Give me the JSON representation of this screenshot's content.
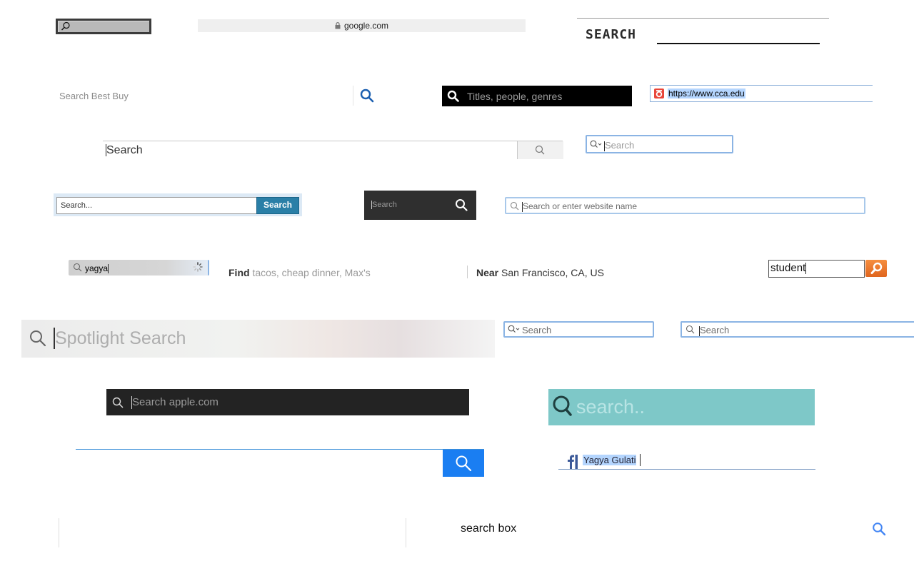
{
  "boxes": {
    "url_bar": {
      "text": "google.com"
    },
    "pixel": {
      "label": "SEARCH"
    },
    "bestbuy": {
      "placeholder": "Search Best Buy"
    },
    "netflix": {
      "placeholder": "Titles, people, genres"
    },
    "cca": {
      "url": "https://www.cca.edu"
    },
    "google": {
      "text": "Search"
    },
    "mac_small_1": {
      "placeholder": "Search"
    },
    "blue_form": {
      "placeholder": "Search...",
      "button": "Search"
    },
    "dark_form": {
      "placeholder": "Search"
    },
    "safari": {
      "placeholder": "Search or enter website name"
    },
    "loading": {
      "value": "yagya"
    },
    "yelp": {
      "find_label": "Find",
      "find_placeholder": "tacos, cheap dinner, Max's",
      "near_label": "Near",
      "near_value": "San Francisco, CA, US"
    },
    "student": {
      "value": "student"
    },
    "spotlight": {
      "placeholder": "Spotlight Search"
    },
    "mac_small_2": {
      "placeholder": "Search"
    },
    "mac_small_3": {
      "placeholder": "Search"
    },
    "apple": {
      "placeholder": "Search apple.com"
    },
    "teal": {
      "placeholder": "search.."
    },
    "facebook": {
      "selected_text": "Yagya Gulati"
    },
    "google_box": {
      "value": "search box"
    }
  },
  "colors": {
    "netflix_bg": "#000000",
    "blue_button": "#2a7fa7",
    "orange_button": "#e0651e",
    "teal_bg": "#7ec8c8",
    "apple_bg": "#232323",
    "blue_search_button": "#1a7ef2",
    "google_blue": "#4285f4",
    "bestbuy_blue": "#1b5fb0",
    "facebook_blue": "#3b5998",
    "focus_ring": "#8bb4e4"
  },
  "icons": [
    "magnifier-icon",
    "lock-icon",
    "spinner-icon",
    "facebook-logo-icon",
    "cca-logo-icon"
  ]
}
